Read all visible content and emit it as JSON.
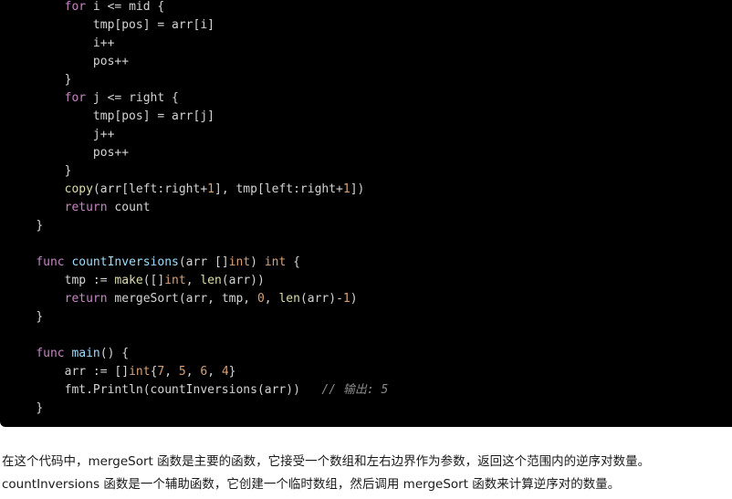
{
  "code_block": {
    "language": "go",
    "background_color": "#000000",
    "colors": {
      "keyword": "#c586c0",
      "function_call": "#dcdcaa",
      "function_name": "#9cdcfe",
      "type": "#d7a074",
      "number": "#d7a074",
      "plain": "#d4d4d4",
      "comment": "#8a8a8a"
    },
    "lines": [
      {
        "indent": 2,
        "tokens": [
          {
            "t": "for",
            "c": "kw"
          },
          {
            "t": " i <= mid {",
            "c": "plain"
          }
        ]
      },
      {
        "indent": 3,
        "tokens": [
          {
            "t": "tmp[pos] = arr[i]",
            "c": "plain"
          }
        ]
      },
      {
        "indent": 3,
        "tokens": [
          {
            "t": "i++",
            "c": "plain"
          }
        ]
      },
      {
        "indent": 3,
        "tokens": [
          {
            "t": "pos++",
            "c": "plain"
          }
        ]
      },
      {
        "indent": 2,
        "tokens": [
          {
            "t": "}",
            "c": "plain"
          }
        ]
      },
      {
        "indent": 2,
        "tokens": [
          {
            "t": "for",
            "c": "kw"
          },
          {
            "t": " j <= right {",
            "c": "plain"
          }
        ]
      },
      {
        "indent": 3,
        "tokens": [
          {
            "t": "tmp[pos] = arr[j]",
            "c": "plain"
          }
        ]
      },
      {
        "indent": 3,
        "tokens": [
          {
            "t": "j++",
            "c": "plain"
          }
        ]
      },
      {
        "indent": 3,
        "tokens": [
          {
            "t": "pos++",
            "c": "plain"
          }
        ]
      },
      {
        "indent": 2,
        "tokens": [
          {
            "t": "}",
            "c": "plain"
          }
        ]
      },
      {
        "indent": 2,
        "tokens": [
          {
            "t": "copy",
            "c": "fn"
          },
          {
            "t": "(arr[left:right+",
            "c": "plain"
          },
          {
            "t": "1",
            "c": "num"
          },
          {
            "t": "], tmp[left:right+",
            "c": "plain"
          },
          {
            "t": "1",
            "c": "num"
          },
          {
            "t": "])",
            "c": "plain"
          }
        ]
      },
      {
        "indent": 2,
        "tokens": [
          {
            "t": "return",
            "c": "kw"
          },
          {
            "t": " count",
            "c": "plain"
          }
        ]
      },
      {
        "indent": 1,
        "tokens": [
          {
            "t": "}",
            "c": "plain"
          }
        ]
      },
      {
        "indent": 0,
        "tokens": []
      },
      {
        "indent": 1,
        "tokens": [
          {
            "t": "func",
            "c": "kw"
          },
          {
            "t": " ",
            "c": "plain"
          },
          {
            "t": "countInversions",
            "c": "fname"
          },
          {
            "t": "(arr []",
            "c": "plain"
          },
          {
            "t": "int",
            "c": "typ"
          },
          {
            "t": ") ",
            "c": "plain"
          },
          {
            "t": "int",
            "c": "typ"
          },
          {
            "t": " {",
            "c": "plain"
          }
        ]
      },
      {
        "indent": 2,
        "tokens": [
          {
            "t": "tmp := ",
            "c": "plain"
          },
          {
            "t": "make",
            "c": "fn"
          },
          {
            "t": "([]",
            "c": "plain"
          },
          {
            "t": "int",
            "c": "typ"
          },
          {
            "t": ", ",
            "c": "plain"
          },
          {
            "t": "len",
            "c": "fn"
          },
          {
            "t": "(arr))",
            "c": "plain"
          }
        ]
      },
      {
        "indent": 2,
        "tokens": [
          {
            "t": "return",
            "c": "kw"
          },
          {
            "t": " mergeSort(arr, tmp, ",
            "c": "plain"
          },
          {
            "t": "0",
            "c": "num"
          },
          {
            "t": ", ",
            "c": "plain"
          },
          {
            "t": "len",
            "c": "fn"
          },
          {
            "t": "(arr)-",
            "c": "plain"
          },
          {
            "t": "1",
            "c": "num"
          },
          {
            "t": ")",
            "c": "plain"
          }
        ]
      },
      {
        "indent": 1,
        "tokens": [
          {
            "t": "}",
            "c": "plain"
          }
        ]
      },
      {
        "indent": 0,
        "tokens": []
      },
      {
        "indent": 1,
        "tokens": [
          {
            "t": "func",
            "c": "kw"
          },
          {
            "t": " ",
            "c": "plain"
          },
          {
            "t": "main",
            "c": "fname"
          },
          {
            "t": "() {",
            "c": "plain"
          }
        ]
      },
      {
        "indent": 2,
        "tokens": [
          {
            "t": "arr := []",
            "c": "plain"
          },
          {
            "t": "int",
            "c": "typ"
          },
          {
            "t": "{",
            "c": "plain"
          },
          {
            "t": "7",
            "c": "num"
          },
          {
            "t": ", ",
            "c": "plain"
          },
          {
            "t": "5",
            "c": "num"
          },
          {
            "t": ", ",
            "c": "plain"
          },
          {
            "t": "6",
            "c": "num"
          },
          {
            "t": ", ",
            "c": "plain"
          },
          {
            "t": "4",
            "c": "num"
          },
          {
            "t": "}",
            "c": "plain"
          }
        ]
      },
      {
        "indent": 2,
        "tokens": [
          {
            "t": "fmt.Println(countInversions(arr))",
            "c": "plain"
          },
          {
            "t": "   // 输出: 5",
            "c": "cmt"
          }
        ]
      },
      {
        "indent": 1,
        "tokens": [
          {
            "t": "}",
            "c": "plain"
          }
        ]
      }
    ]
  },
  "prose": {
    "paragraphs": [
      "在这个代码中，mergeSort 函数是主要的函数，它接受一个数组和左右边界作为参数，返回这个范围内的逆序对数量。",
      "countInversions 函数是一个辅助函数，它创建一个临时数组，然后调用 mergeSort 函数来计算逆序对的数量。"
    ]
  }
}
